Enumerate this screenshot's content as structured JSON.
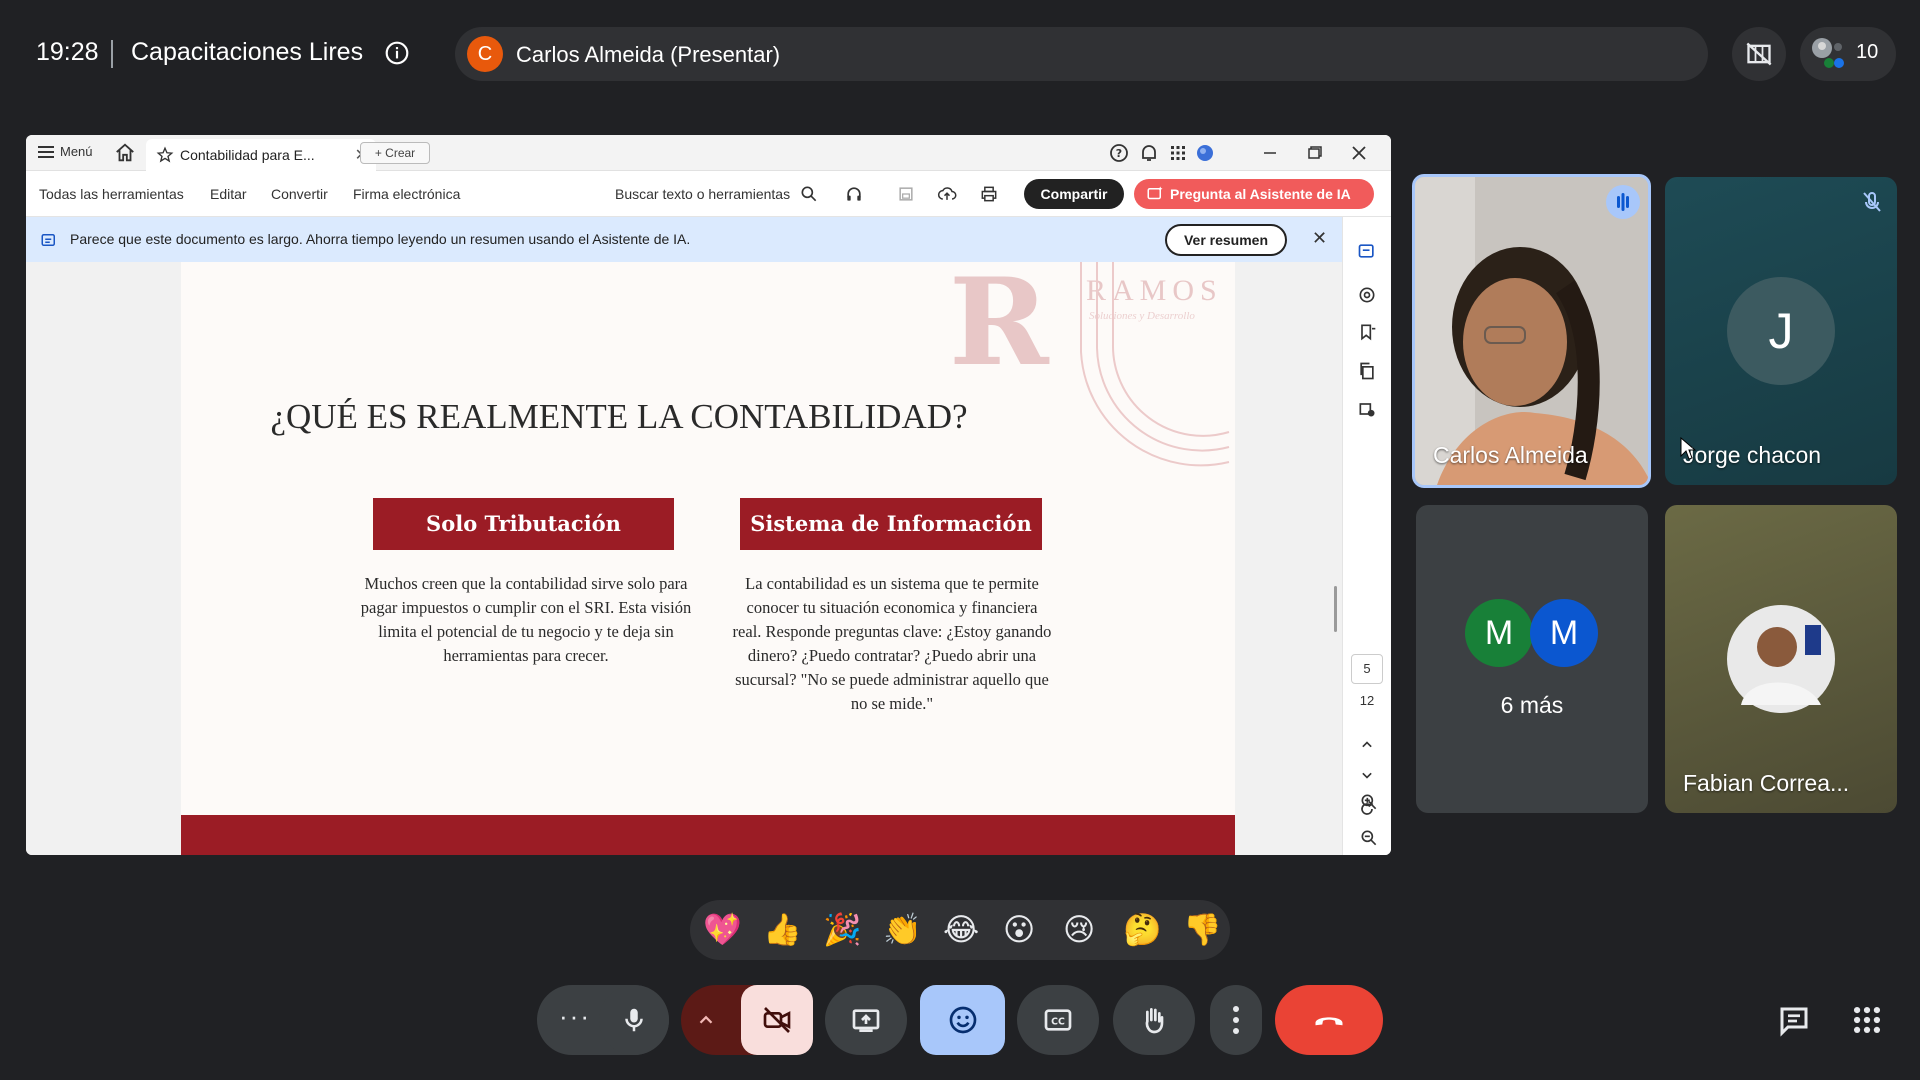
{
  "topbar": {
    "time": "19:28",
    "meeting_title": "Capacitaciones Lires",
    "presenter_initial": "C",
    "presenter_label": "Carlos Almeida (Presentar)",
    "participant_count": "10"
  },
  "shared_window": {
    "menu_label": "Menú",
    "tab_label": "Contabilidad para E...",
    "crear_label": "+ Crear",
    "toolbar": {
      "all_tools": "Todas las herramientas",
      "edit": "Editar",
      "convert": "Convertir",
      "esign": "Firma electrónica",
      "search": "Buscar texto o herramientas",
      "share": "Compartir",
      "ai_assistant": "Pregunta al Asistente de IA"
    },
    "banner": {
      "text": "Parece que este documento es largo. Ahorra tiempo leyendo un resumen usando el Asistente de IA.",
      "button": "Ver resumen"
    },
    "slide": {
      "logo_letter": "R",
      "logo_text": "RAMOS",
      "logo_subtext": "Soluciones y Desarrollo",
      "title": "¿QUÉ ES REALMENTE LA CONTABILIDAD?",
      "left_heading": "Solo Tributación",
      "left_text": "Muchos creen que la contabilidad sirve solo para pagar impuestos o cumplir con el SRI. Esta visión limita el potencial de tu negocio y te deja sin herramientas para crecer.",
      "right_heading": "Sistema de Información",
      "right_text": "La contabilidad es un sistema que te permite conocer tu situación economica y financiera real. Responde preguntas clave: ¿Estoy ganando dinero? ¿Puedo contratar? ¿Puedo abrir una sucursal? \"No se puede administrar aquello que no se mide.\""
    },
    "page_current": "5",
    "page_total": "12"
  },
  "participants": {
    "carlos": "Carlos Almeida",
    "jorge_initial": "J",
    "jorge": "Jorge chacon",
    "more_initial_1": "M",
    "more_initial_2": "M",
    "more_label": "6 más",
    "fabian": "Fabian Correa..."
  },
  "reactions": [
    "💖",
    "👍",
    "🎉",
    "👏",
    "😂",
    "😮",
    "😢",
    "🤔",
    "👎"
  ],
  "colors": {
    "background": "#202124",
    "presenter_avatar": "#e8590c",
    "active_speaker_border": "#a8c7fa",
    "end_call": "#ea4335",
    "camera_off": "#f9dedc",
    "reactions_active": "#a8c7fa",
    "slide_accent": "#9b1c25"
  }
}
